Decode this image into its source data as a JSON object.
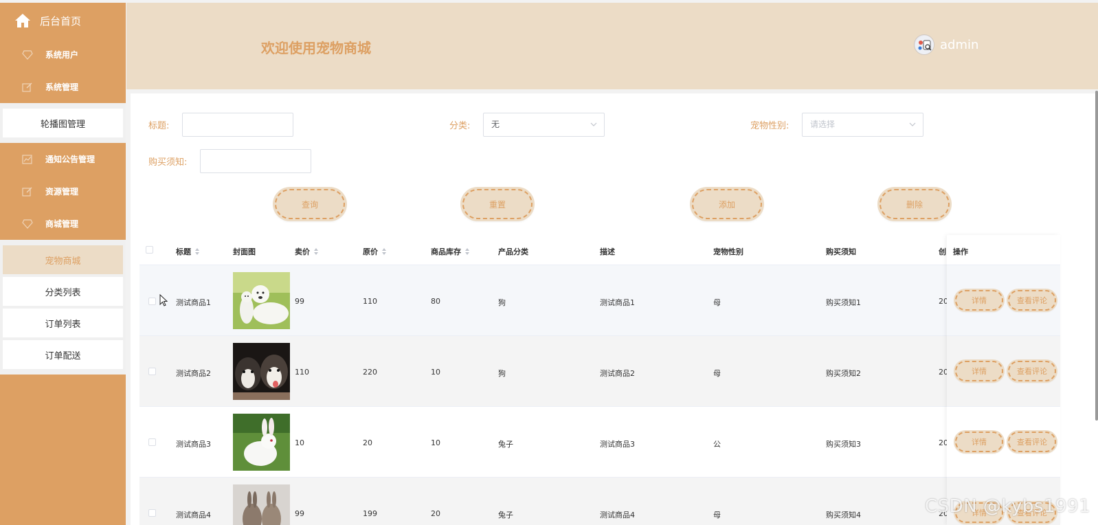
{
  "sidebar": {
    "home": "后台首页",
    "items": [
      {
        "label": "系统用户",
        "icon": "diamond-icon"
      },
      {
        "label": "系统管理",
        "icon": "edit-icon"
      }
    ],
    "sub1": [
      {
        "label": "轮播图管理"
      }
    ],
    "items2": [
      {
        "label": "通知公告管理",
        "icon": "chart-icon"
      },
      {
        "label": "资源管理",
        "icon": "edit-icon"
      },
      {
        "label": "商城管理",
        "icon": "diamond-icon"
      }
    ],
    "sub2": [
      {
        "label": "宠物商城",
        "active": true
      },
      {
        "label": "分类列表"
      },
      {
        "label": "订单列表"
      },
      {
        "label": "订单配送"
      }
    ]
  },
  "header": {
    "welcome": "欢迎使用宠物商城",
    "username": "admin"
  },
  "filters": {
    "title_label": "标题:",
    "title_value": "",
    "category_label": "分类:",
    "category_value": "无",
    "gender_label": "宠物性别:",
    "gender_placeholder": "请选择",
    "notice_label": "购买须知:",
    "notice_value": ""
  },
  "buttons": {
    "search": "查询",
    "reset": "重置",
    "add": "添加",
    "delete": "删除"
  },
  "table": {
    "headers": [
      "标题",
      "封面图",
      "卖价",
      "原价",
      "商品库存",
      "产品分类",
      "描述",
      "宠物性别",
      "购买须知",
      "创",
      "操作"
    ],
    "rows": [
      {
        "title": "测试商品1",
        "price": "99",
        "original": "110",
        "stock": "80",
        "category": "狗",
        "desc": "测试商品1",
        "gender": "母",
        "notice": "购买须知1",
        "created": "20",
        "image": "white-dogs"
      },
      {
        "title": "测试商品2",
        "price": "110",
        "original": "220",
        "stock": "10",
        "category": "狗",
        "desc": "测试商品2",
        "gender": "母",
        "notice": "购买须知2",
        "created": "20",
        "image": "husky-puppies"
      },
      {
        "title": "测试商品3",
        "price": "10",
        "original": "20",
        "stock": "10",
        "category": "兔子",
        "desc": "测试商品3",
        "gender": "公",
        "notice": "购买须知3",
        "created": "20",
        "image": "white-rabbit"
      },
      {
        "title": "测试商品4",
        "price": "99",
        "original": "199",
        "stock": "20",
        "category": "兔子",
        "desc": "测试商品4",
        "gender": "母",
        "notice": "购买须知4",
        "created": "20",
        "image": "rabbits"
      }
    ],
    "op_detail": "详情",
    "op_comments": "查看评论"
  },
  "watermark": "CSDN @kybs1991",
  "colors": {
    "accent": "#dda063",
    "accent_light": "#ecdcc6"
  }
}
